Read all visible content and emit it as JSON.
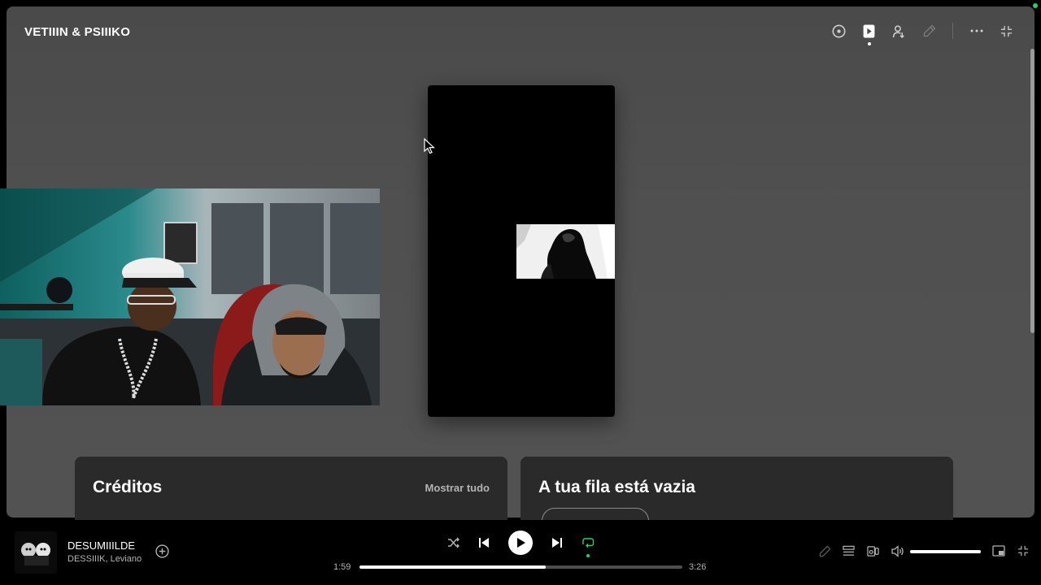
{
  "now_playing_view": {
    "title": "VETIIIN & PSIIIKO",
    "top_icons": [
      "disc-icon",
      "now-playing-view-icon",
      "friend-activity-icon",
      "pencil-icon",
      "more-icon",
      "collapse-icon"
    ]
  },
  "canvas": {
    "cursor": "pointer-cursor"
  },
  "credits": {
    "title": "Créditos",
    "show_all": "Mostrar tudo"
  },
  "queue": {
    "title": "A tua fila está vazia"
  },
  "player": {
    "track_name": "DESUMIIILDE",
    "artists": "DESSIIIK, Leviano",
    "current_time": "1:59",
    "total_time": "3:26",
    "progress": 0.578,
    "volume": 1.0,
    "repeat_active": true,
    "accent_color": "#1ed760"
  }
}
